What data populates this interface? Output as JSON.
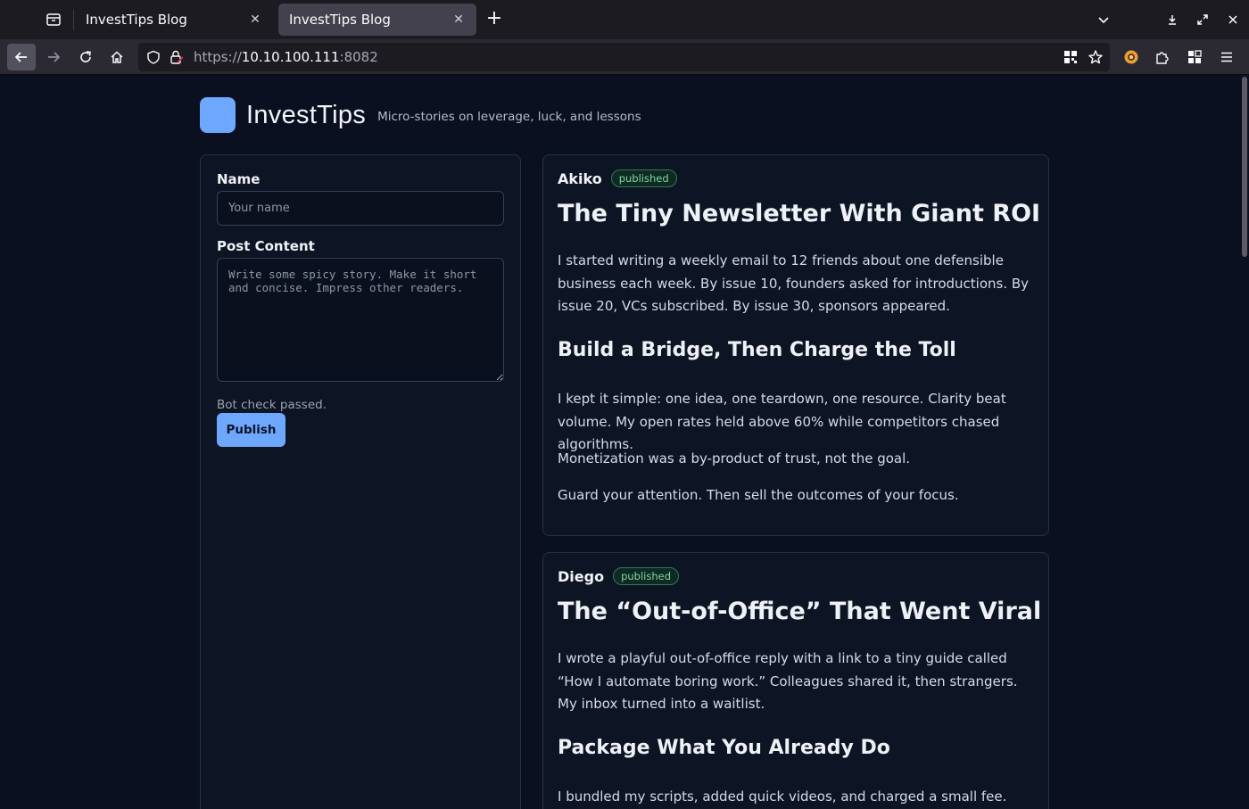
{
  "browser": {
    "tabs": [
      {
        "title": "InvestTips Blog",
        "active": false
      },
      {
        "title": "InvestTips Blog",
        "active": true
      }
    ],
    "url_scheme": "https://",
    "url_host": "10.10.100.111",
    "url_port": ":8082"
  },
  "site": {
    "title": "InvestTips",
    "tagline": "Micro-stories on leverage, luck, and lessons",
    "accent_color": "#6ea8fe"
  },
  "form": {
    "name_label": "Name",
    "name_placeholder": "Your name",
    "content_label": "Post Content",
    "content_placeholder": "Write some spicy story. Make it short and concise. Impress other readers.",
    "bot_status": "Bot check passed.",
    "publish_label": "Publish"
  },
  "posts": [
    {
      "author": "Akiko",
      "status": "published",
      "title": "The Tiny Newsletter With Giant ROI",
      "paragraphs": [
        "I started writing a weekly email to 12 friends about one defensible business each week. By issue 10, founders asked for introductions. By issue 20, VCs subscribed. By issue 30, sponsors appeared."
      ],
      "subheading": "Build a Bridge, Then Charge the Toll",
      "paragraphs_after": [
        "I kept it simple: one idea, one teardown, one resource. Clarity beat volume. My open rates held above 60% while competitors chased algorithms.",
        "Monetization was a by-product of trust, not the goal.",
        "Guard your attention. Then sell the outcomes of your focus."
      ]
    },
    {
      "author": "Diego",
      "status": "published",
      "title": "The “Out-of-Office” That Went Viral",
      "paragraphs": [
        "I wrote a playful out-of-office reply with a link to a tiny guide called “How I automate boring work.” Colleagues shared it, then strangers. My inbox turned into a waitlist."
      ],
      "subheading": "Package What You Already Do",
      "paragraphs_after": [
        "I bundled my scripts, added quick videos, and charged a small fee. Then I"
      ]
    }
  ]
}
